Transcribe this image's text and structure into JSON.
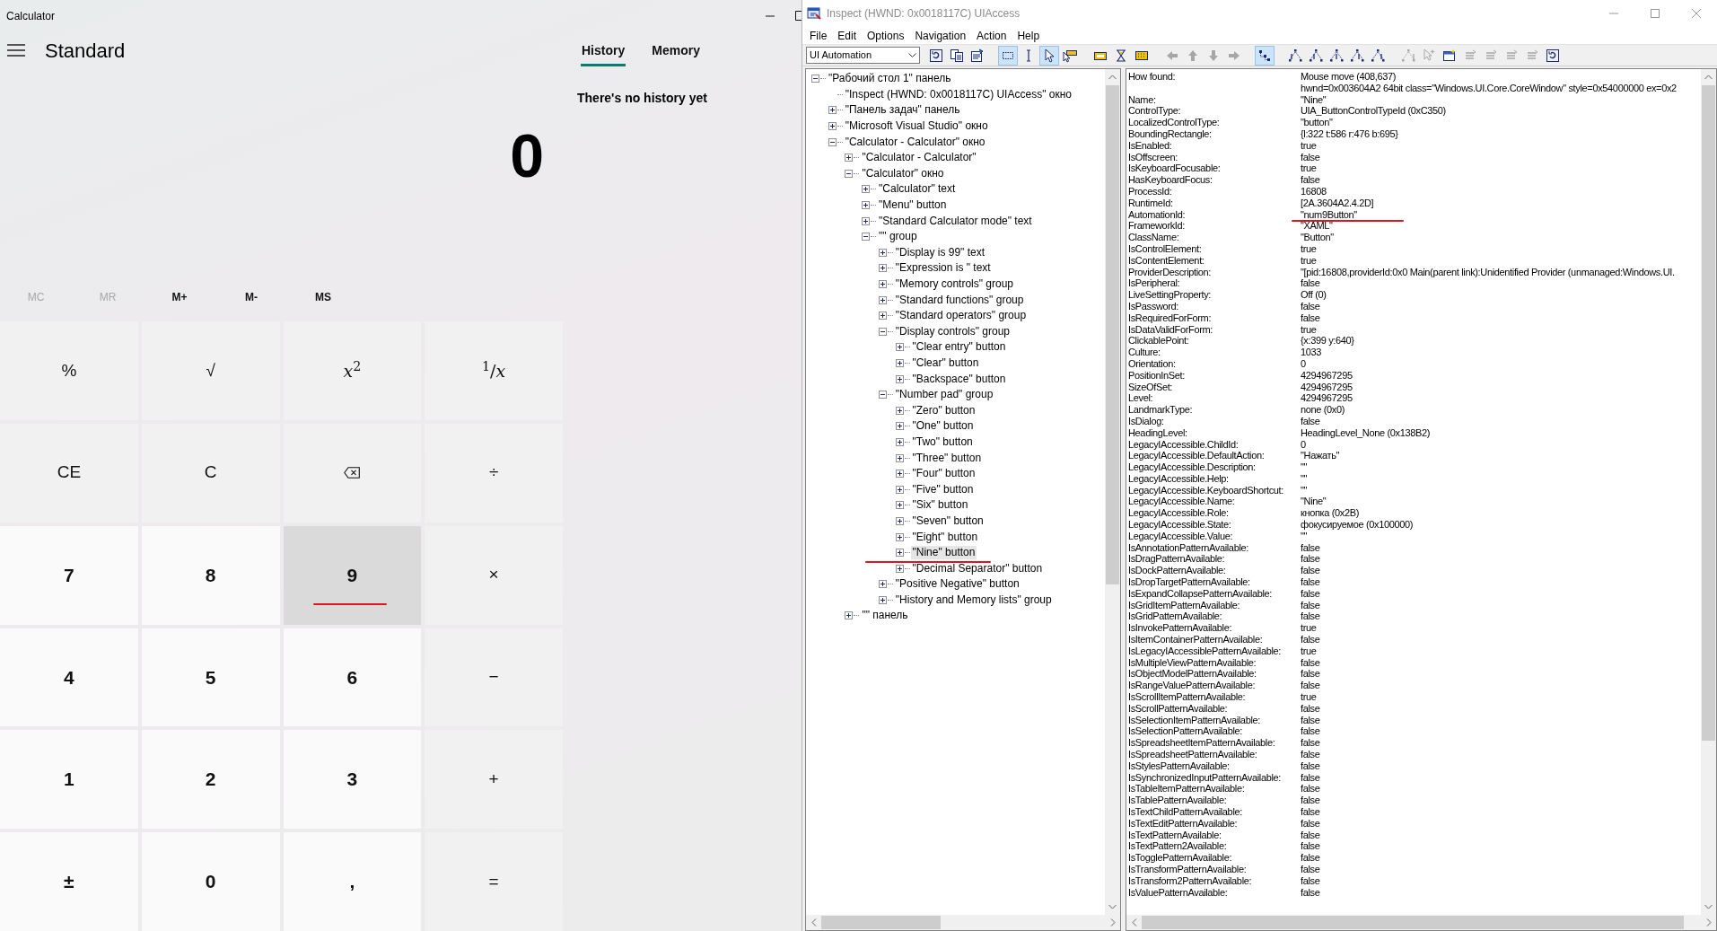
{
  "calculator": {
    "window_title": "Calculator",
    "mode": "Standard",
    "tabs": [
      {
        "label": "History",
        "selected": true
      },
      {
        "label": "Memory",
        "selected": false
      }
    ],
    "history_message": "There's no history yet",
    "display": "0",
    "memory_buttons": [
      {
        "label": "MC",
        "disabled": true
      },
      {
        "label": "MR",
        "disabled": true
      },
      {
        "label": "M+",
        "disabled": false
      },
      {
        "label": "M-",
        "disabled": false
      },
      {
        "label": "MS",
        "disabled": false
      }
    ],
    "keys": [
      {
        "label": "%",
        "kind": "function",
        "hovered": false,
        "marked": false
      },
      {
        "label": "√",
        "kind": "function",
        "hovered": false,
        "marked": false
      },
      {
        "label": "*x*$^{2}$",
        "kind": "function",
        "hovered": false,
        "marked": false
      },
      {
        "label": "$^{1}$/*x*",
        "kind": "function",
        "hovered": false,
        "marked": false
      },
      {
        "label": "CE",
        "kind": "function",
        "hovered": false,
        "marked": false
      },
      {
        "label": "C",
        "kind": "function",
        "hovered": false,
        "marked": false
      },
      {
        "kind": "backspace",
        "hovered": false,
        "marked": false
      },
      {
        "label": "÷",
        "kind": "operator",
        "hovered": false,
        "marked": false
      },
      {
        "label": "7",
        "kind": "digit",
        "hovered": false,
        "marked": false
      },
      {
        "label": "8",
        "kind": "digit",
        "hovered": false,
        "marked": false
      },
      {
        "label": "9",
        "kind": "digit",
        "hovered": true,
        "marked": true
      },
      {
        "label": "×",
        "kind": "operator",
        "hovered": false,
        "marked": false
      },
      {
        "label": "4",
        "kind": "digit",
        "hovered": false,
        "marked": false
      },
      {
        "label": "5",
        "kind": "digit",
        "hovered": false,
        "marked": false
      },
      {
        "label": "6",
        "kind": "digit",
        "hovered": false,
        "marked": false
      },
      {
        "label": "−",
        "kind": "operator",
        "hovered": false,
        "marked": false
      },
      {
        "label": "1",
        "kind": "digit",
        "hovered": false,
        "marked": false
      },
      {
        "label": "2",
        "kind": "digit",
        "hovered": false,
        "marked": false
      },
      {
        "label": "3",
        "kind": "digit",
        "hovered": false,
        "marked": false
      },
      {
        "label": "+",
        "kind": "operator",
        "hovered": false,
        "marked": false
      },
      {
        "label": "±",
        "kind": "digit",
        "hovered": false,
        "marked": false
      },
      {
        "label": "0",
        "kind": "digit",
        "hovered": false,
        "marked": false
      },
      {
        "label": ",",
        "kind": "digit",
        "hovered": false,
        "marked": false
      },
      {
        "label": "=",
        "kind": "operator",
        "hovered": false,
        "marked": false
      }
    ]
  },
  "inspect": {
    "window_title": "Inspect  (HWND: 0x0018117C) UIAccess",
    "menu": [
      "File",
      "Edit",
      "Options",
      "Navigation",
      "Action",
      "Help"
    ],
    "toolbar": {
      "mode_select": "UI Automation",
      "buttons": [
        {
          "pressed": false,
          "disabled": false
        },
        {
          "pressed": false,
          "disabled": false
        },
        {
          "pressed": false,
          "disabled": false
        },
        {
          "pressed": true,
          "disabled": false
        },
        {
          "pressed": false,
          "disabled": false
        },
        {
          "pressed": true,
          "disabled": false
        },
        {
          "pressed": false,
          "disabled": false
        },
        {
          "pressed": false,
          "disabled": false
        },
        {
          "pressed": false,
          "disabled": false
        },
        {
          "pressed": false,
          "disabled": false
        },
        {
          "pressed": false,
          "disabled": true
        },
        {
          "pressed": false,
          "disabled": true
        },
        {
          "pressed": false,
          "disabled": true
        },
        {
          "pressed": false,
          "disabled": true
        },
        {
          "pressed": true,
          "disabled": false
        },
        {
          "pressed": false,
          "disabled": false
        },
        {
          "pressed": false,
          "disabled": false
        },
        {
          "pressed": false,
          "disabled": false
        },
        {
          "pressed": false,
          "disabled": false
        },
        {
          "pressed": false,
          "disabled": false
        },
        {
          "pressed": false,
          "disabled": true
        },
        {
          "pressed": false,
          "disabled": true
        },
        {
          "pressed": false,
          "disabled": false
        },
        {
          "pressed": false,
          "disabled": true
        },
        {
          "pressed": false,
          "disabled": true
        },
        {
          "pressed": false,
          "disabled": true
        },
        {
          "pressed": false,
          "disabled": true
        },
        {
          "pressed": false,
          "disabled": false
        }
      ]
    },
    "tree": [
      {
        "label": "\"Рабочий стол 1\" панель",
        "expandable": true,
        "expanded": true,
        "selected": false,
        "marked": false,
        "children": [
          {
            "label": "\"Inspect  (HWND: 0x0018117C) UIAccess\" окно",
            "expandable": false,
            "selected": false,
            "marked": false
          },
          {
            "label": "\"Панель задач\" панель",
            "expandable": true,
            "expanded": false,
            "selected": false,
            "marked": false
          },
          {
            "label": "\"Microsoft Visual Studio\" окно",
            "expandable": true,
            "expanded": false,
            "selected": false,
            "marked": false
          },
          {
            "label": "\"Calculator - Calculator\" окно",
            "expandable": true,
            "expanded": true,
            "selected": false,
            "marked": false,
            "children": [
              {
                "label": "\"Calculator - Calculator\"",
                "expandable": true,
                "expanded": false,
                "selected": false,
                "marked": false
              },
              {
                "label": "\"Calculator\" окно",
                "expandable": true,
                "expanded": true,
                "selected": false,
                "marked": false,
                "children": [
                  {
                    "label": "\"Calculator\" text",
                    "expandable": true,
                    "expanded": false,
                    "selected": false,
                    "marked": false
                  },
                  {
                    "label": "\"Menu\" button",
                    "expandable": true,
                    "expanded": false,
                    "selected": false,
                    "marked": false
                  },
                  {
                    "label": "\"Standard Calculator mode\" text",
                    "expandable": true,
                    "expanded": false,
                    "selected": false,
                    "marked": false
                  },
                  {
                    "label": "\"\" group",
                    "expandable": true,
                    "expanded": true,
                    "selected": false,
                    "marked": false,
                    "children": [
                      {
                        "label": "\"Display is 99\" text",
                        "expandable": true,
                        "expanded": false,
                        "selected": false,
                        "marked": false
                      },
                      {
                        "label": "\"Expression is \" text",
                        "expandable": true,
                        "expanded": false,
                        "selected": false,
                        "marked": false
                      },
                      {
                        "label": "\"Memory controls\" group",
                        "expandable": true,
                        "expanded": false,
                        "selected": false,
                        "marked": false
                      },
                      {
                        "label": "\"Standard functions\" group",
                        "expandable": true,
                        "expanded": false,
                        "selected": false,
                        "marked": false
                      },
                      {
                        "label": "\"Standard operators\" group",
                        "expandable": true,
                        "expanded": false,
                        "selected": false,
                        "marked": false
                      },
                      {
                        "label": "\"Display controls\" group",
                        "expandable": true,
                        "expanded": true,
                        "selected": false,
                        "marked": false,
                        "children": [
                          {
                            "label": "\"Clear entry\" button",
                            "expandable": true,
                            "expanded": false,
                            "selected": false,
                            "marked": false
                          },
                          {
                            "label": "\"Clear\" button",
                            "expandable": true,
                            "expanded": false,
                            "selected": false,
                            "marked": false
                          },
                          {
                            "label": "\"Backspace\" button",
                            "expandable": true,
                            "expanded": false,
                            "selected": false,
                            "marked": false
                          }
                        ]
                      },
                      {
                        "label": "\"Number pad\" group",
                        "expandable": true,
                        "expanded": true,
                        "selected": false,
                        "marked": false,
                        "children": [
                          {
                            "label": "\"Zero\" button",
                            "expandable": true,
                            "expanded": false,
                            "selected": false,
                            "marked": false
                          },
                          {
                            "label": "\"One\" button",
                            "expandable": true,
                            "expanded": false,
                            "selected": false,
                            "marked": false
                          },
                          {
                            "label": "\"Two\" button",
                            "expandable": true,
                            "expanded": false,
                            "selected": false,
                            "marked": false
                          },
                          {
                            "label": "\"Three\" button",
                            "expandable": true,
                            "expanded": false,
                            "selected": false,
                            "marked": false
                          },
                          {
                            "label": "\"Four\" button",
                            "expandable": true,
                            "expanded": false,
                            "selected": false,
                            "marked": false
                          },
                          {
                            "label": "\"Five\" button",
                            "expandable": true,
                            "expanded": false,
                            "selected": false,
                            "marked": false
                          },
                          {
                            "label": "\"Six\" button",
                            "expandable": true,
                            "expanded": false,
                            "selected": false,
                            "marked": false
                          },
                          {
                            "label": "\"Seven\" button",
                            "expandable": true,
                            "expanded": false,
                            "selected": false,
                            "marked": false
                          },
                          {
                            "label": "\"Eight\" button",
                            "expandable": true,
                            "expanded": false,
                            "selected": false,
                            "marked": false
                          },
                          {
                            "label": "\"Nine\" button",
                            "expandable": true,
                            "expanded": false,
                            "selected": true,
                            "marked": true
                          },
                          {
                            "label": "\"Decimal Separator\" button",
                            "expandable": true,
                            "expanded": false,
                            "selected": false,
                            "marked": false
                          }
                        ]
                      },
                      {
                        "label": "\"Positive Negative\" button",
                        "expandable": true,
                        "expanded": false,
                        "selected": false,
                        "marked": false
                      },
                      {
                        "label": "\"History and Memory lists\" group",
                        "expandable": true,
                        "expanded": false,
                        "selected": false,
                        "marked": false
                      }
                    ]
                  }
                ]
              },
              {
                "label": "\"\" панель",
                "expandable": true,
                "expanded": false,
                "selected": false,
                "marked": false
              }
            ]
          }
        ]
      }
    ],
    "properties": [
      {
        "label": "How found:",
        "value": "Mouse move (408,637)",
        "extra_line": "hwnd=0x003604A2 64bit class=\"Windows.UI.Core.CoreWindow\" style=0x54000000 ex=0x2",
        "marked": false
      },
      {
        "label": "Name:",
        "value": "\"Nine\"",
        "marked": false
      },
      {
        "label": "ControlType:",
        "value": "UIA_ButtonControlTypeId (0xC350)",
        "marked": false
      },
      {
        "label": "LocalizedControlType:",
        "value": "\"button\"",
        "marked": false
      },
      {
        "label": "BoundingRectangle:",
        "value": "{l:322 t:586 r:476 b:695}",
        "marked": false
      },
      {
        "label": "IsEnabled:",
        "value": "true",
        "marked": false
      },
      {
        "label": "IsOffscreen:",
        "value": "false",
        "marked": false
      },
      {
        "label": "IsKeyboardFocusable:",
        "value": "true",
        "marked": false
      },
      {
        "label": "HasKeyboardFocus:",
        "value": "false",
        "marked": false
      },
      {
        "label": "ProcessId:",
        "value": "16808",
        "marked": false
      },
      {
        "label": "RuntimeId:",
        "value": "[2A.3604A2.4.2D]",
        "marked": false
      },
      {
        "label": "AutomationId:",
        "value": "\"num9Button\"",
        "marked": true
      },
      {
        "label": "FrameworkId:",
        "value": "\"XAML\"",
        "marked": false
      },
      {
        "label": "ClassName:",
        "value": "\"Button\"",
        "marked": false
      },
      {
        "label": "IsControlElement:",
        "value": "true",
        "marked": false
      },
      {
        "label": "IsContentElement:",
        "value": "true",
        "marked": false
      },
      {
        "label": "ProviderDescription:",
        "value": "\"[pid:16808,providerId:0x0 Main(parent link):Unidentified Provider (unmanaged:Windows.UI.",
        "marked": false
      },
      {
        "label": "IsPeripheral:",
        "value": "false",
        "marked": false
      },
      {
        "label": "LiveSettingProperty:",
        "value": "Off (0)",
        "marked": false
      },
      {
        "label": "IsPassword:",
        "value": "false",
        "marked": false
      },
      {
        "label": "IsRequiredForForm:",
        "value": "false",
        "marked": false
      },
      {
        "label": "IsDataValidForForm:",
        "value": "true",
        "marked": false
      },
      {
        "label": "ClickablePoint:",
        "value": "{x:399 y:640}",
        "marked": false
      },
      {
        "label": "Culture:",
        "value": "1033",
        "marked": false
      },
      {
        "label": "Orientation:",
        "value": "0",
        "marked": false
      },
      {
        "label": "PositionInSet:",
        "value": "4294967295",
        "marked": false
      },
      {
        "label": "SizeOfSet:",
        "value": "4294967295",
        "marked": false
      },
      {
        "label": "Level:",
        "value": "4294967295",
        "marked": false
      },
      {
        "label": "LandmarkType:",
        "value": "none (0x0)",
        "marked": false
      },
      {
        "label": "IsDialog:",
        "value": "false",
        "marked": false
      },
      {
        "label": "HeadingLevel:",
        "value": "HeadingLevel_None (0x138B2)",
        "marked": false
      },
      {
        "label": "LegacyIAccessible.ChildId:",
        "value": "0",
        "marked": false
      },
      {
        "label": "LegacyIAccessible.DefaultAction:",
        "value": "\"Нажать\"",
        "marked": false
      },
      {
        "label": "LegacyIAccessible.Description:",
        "value": "\"\"",
        "marked": false
      },
      {
        "label": "LegacyIAccessible.Help:",
        "value": "\"\"",
        "marked": false
      },
      {
        "label": "LegacyIAccessible.KeyboardShortcut:",
        "value": "\"\"",
        "marked": false
      },
      {
        "label": "LegacyIAccessible.Name:",
        "value": "\"Nine\"",
        "marked": false
      },
      {
        "label": "LegacyIAccessible.Role:",
        "value": "кнопка (0x2B)",
        "marked": false
      },
      {
        "label": "LegacyIAccessible.State:",
        "value": "фокусируемое (0x100000)",
        "marked": false
      },
      {
        "label": "LegacyIAccessible.Value:",
        "value": "\"\"",
        "marked": false
      },
      {
        "label": "IsAnnotationPatternAvailable:",
        "value": "false",
        "marked": false
      },
      {
        "label": "IsDragPatternAvailable:",
        "value": "false",
        "marked": false
      },
      {
        "label": "IsDockPatternAvailable:",
        "value": "false",
        "marked": false
      },
      {
        "label": "IsDropTargetPatternAvailable:",
        "value": "false",
        "marked": false
      },
      {
        "label": "IsExpandCollapsePatternAvailable:",
        "value": "false",
        "marked": false
      },
      {
        "label": "IsGridItemPatternAvailable:",
        "value": "false",
        "marked": false
      },
      {
        "label": "IsGridPatternAvailable:",
        "value": "false",
        "marked": false
      },
      {
        "label": "IsInvokePatternAvailable:",
        "value": "true",
        "marked": false
      },
      {
        "label": "IsItemContainerPatternAvailable:",
        "value": "false",
        "marked": false
      },
      {
        "label": "IsLegacyIAccessiblePatternAvailable:",
        "value": "true",
        "marked": false
      },
      {
        "label": "IsMultipleViewPatternAvailable:",
        "value": "false",
        "marked": false
      },
      {
        "label": "IsObjectModelPatternAvailable:",
        "value": "false",
        "marked": false
      },
      {
        "label": "IsRangeValuePatternAvailable:",
        "value": "false",
        "marked": false
      },
      {
        "label": "IsScrollItemPatternAvailable:",
        "value": "true",
        "marked": false
      },
      {
        "label": "IsScrollPatternAvailable:",
        "value": "false",
        "marked": false
      },
      {
        "label": "IsSelectionItemPatternAvailable:",
        "value": "false",
        "marked": false
      },
      {
        "label": "IsSelectionPatternAvailable:",
        "value": "false",
        "marked": false
      },
      {
        "label": "IsSpreadsheetItemPatternAvailable:",
        "value": "false",
        "marked": false
      },
      {
        "label": "IsSpreadsheetPatternAvailable:",
        "value": "false",
        "marked": false
      },
      {
        "label": "IsStylesPatternAvailable:",
        "value": "false",
        "marked": false
      },
      {
        "label": "IsSynchronizedInputPatternAvailable:",
        "value": "false",
        "marked": false
      },
      {
        "label": "IsTableItemPatternAvailable:",
        "value": "false",
        "marked": false
      },
      {
        "label": "IsTablePatternAvailable:",
        "value": "false",
        "marked": false
      },
      {
        "label": "IsTextChildPatternAvailable:",
        "value": "false",
        "marked": false
      },
      {
        "label": "IsTextEditPatternAvailable:",
        "value": "false",
        "marked": false
      },
      {
        "label": "IsTextPatternAvailable:",
        "value": "false",
        "marked": false
      },
      {
        "label": "IsTextPattern2Available:",
        "value": "false",
        "marked": false
      },
      {
        "label": "IsTogglePatternAvailable:",
        "value": "false",
        "marked": false
      },
      {
        "label": "IsTransformPatternAvailable:",
        "value": "false",
        "marked": false
      },
      {
        "label": "IsTransform2PatternAvailable:",
        "value": "false",
        "marked": false
      },
      {
        "label": "IsValuePatternAvailable:",
        "value": "false",
        "marked": false
      }
    ]
  }
}
